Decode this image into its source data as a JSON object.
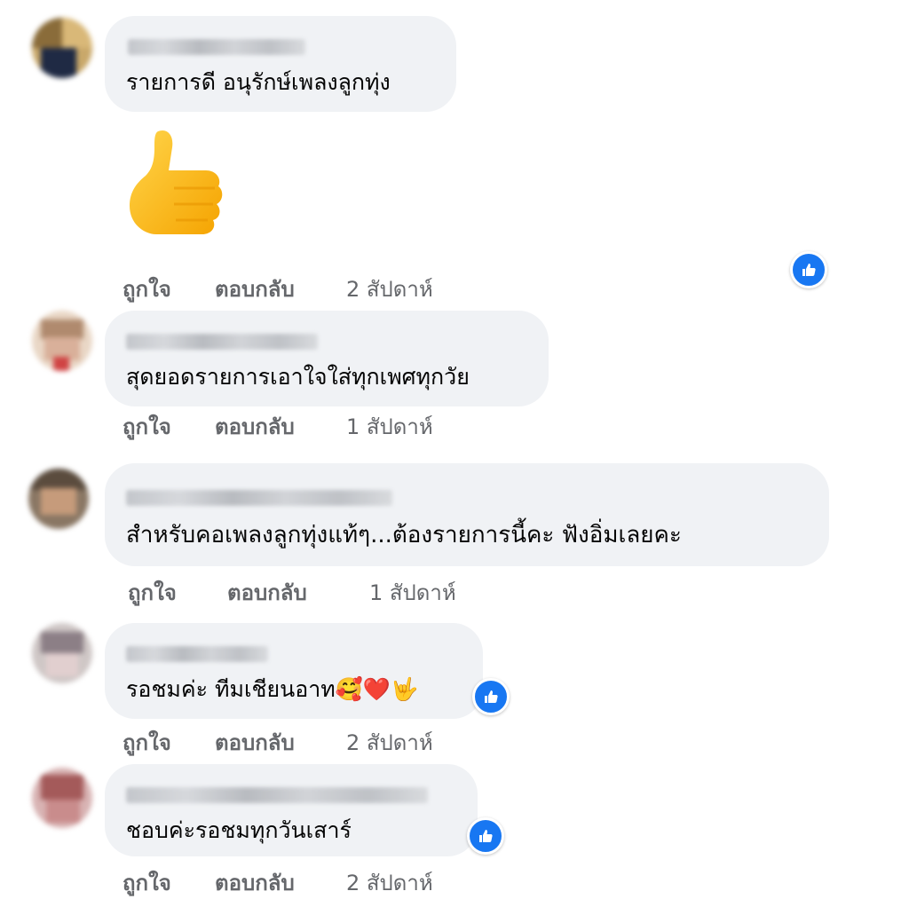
{
  "comments": [
    {
      "text": "รายการดี อนุรักษ์เพลงลูกทุ่ง",
      "like_label": "ถูกใจ",
      "reply_label": "ตอบกลับ",
      "time": "2 สัปดาห์",
      "sticker": "thumbs-up-emoji",
      "has_reaction": true
    },
    {
      "text": "สุดยอดรายการเอาใจใส่ทุกเพศทุกวัย",
      "like_label": "ถูกใจ",
      "reply_label": "ตอบกลับ",
      "time": "1 สัปดาห์",
      "has_reaction": false
    },
    {
      "text": "สำหรับคอเพลงลูกทุ่งแท้ๆ...ต้องรายการนี้คะ ฟังอิ่มเลยคะ",
      "like_label": "ถูกใจ",
      "reply_label": "ตอบกลับ",
      "time": "1 สัปดาห์",
      "has_reaction": false
    },
    {
      "text": "รอชมค่ะ ทีมเชียนอาท🥰❤️🤟",
      "like_label": "ถูกใจ",
      "reply_label": "ตอบกลับ",
      "time": "2 สัปดาห์",
      "has_reaction": true
    },
    {
      "text": "ชอบค่ะรอชมทุกวันเสาร์",
      "like_label": "ถูกใจ",
      "reply_label": "ตอบกลับ",
      "time": "2 สัปดาห์",
      "has_reaction": true
    }
  ],
  "colors": {
    "bubble": "#f0f2f5",
    "meta_text": "#65676b",
    "like_badge": "#1877f2"
  }
}
